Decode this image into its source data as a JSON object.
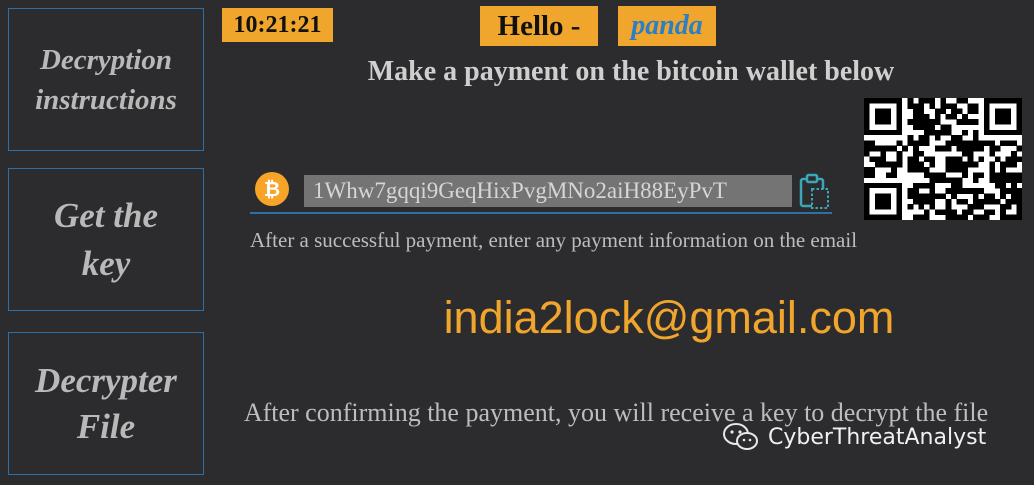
{
  "sidebar": {
    "decryption_instructions": [
      "Decryption",
      "instructions"
    ],
    "get_the_key": [
      "Get the",
      "key"
    ],
    "decrypter_file": [
      "Decrypter",
      "File"
    ]
  },
  "header": {
    "timer": "10:21:21",
    "hello": "Hello -",
    "username": "panda",
    "heading": "Make a payment on the bitcoin wallet below"
  },
  "wallet": {
    "icon": "bitcoin-icon",
    "address": "1Whw7gqqi9GeqHixPvgMNo2aiH88EyPvT",
    "copy_icon": "clipboard-copy-icon"
  },
  "instructions": {
    "after_payment": "After a successful payment, enter any payment information on the email",
    "email": "india2lock@gmail.com",
    "confirm": "After confirming the payment, you will receive a key to decrypt the file"
  },
  "watermark": {
    "text": "CyberThreatAnalyst",
    "icon": "wechat-icon"
  },
  "colors": {
    "background": "#2c2c2e",
    "accent": "#f0a52c",
    "border": "#2f6fa8",
    "username": "#2a7fc7"
  }
}
